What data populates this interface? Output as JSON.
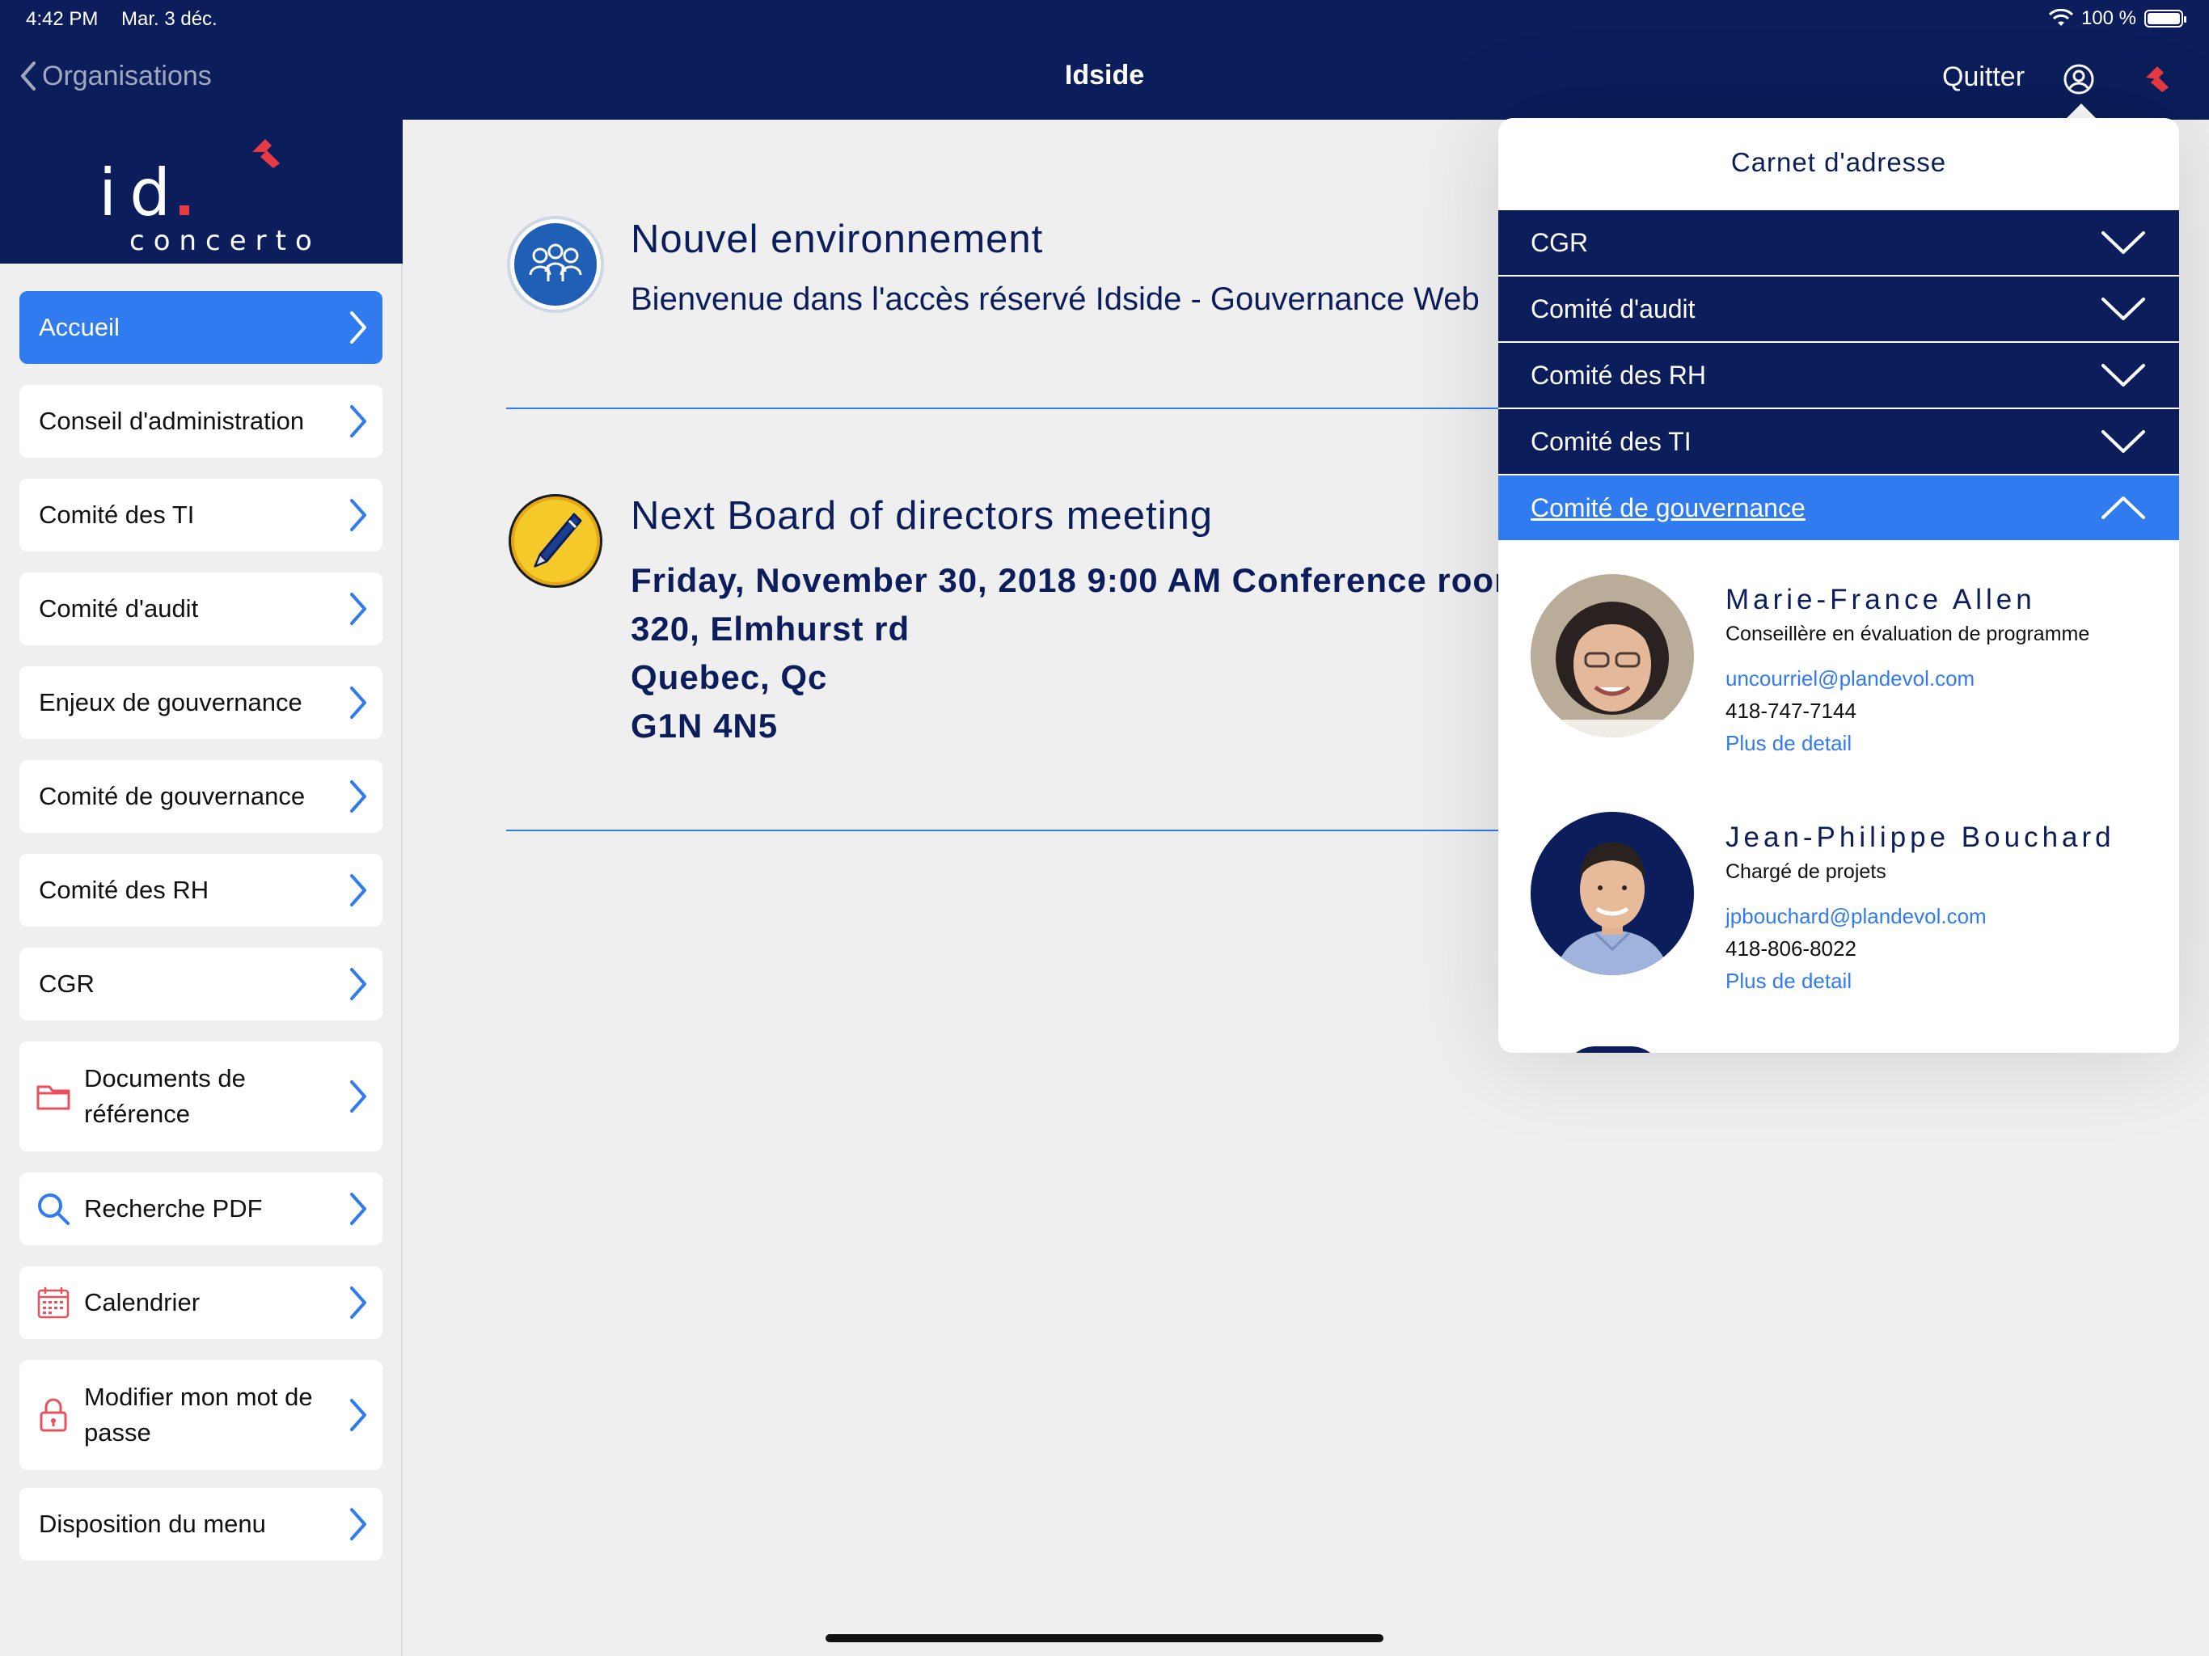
{
  "status_bar": {
    "time": "4:42 PM",
    "date": "Mar. 3 déc.",
    "battery": "100 %"
  },
  "nav": {
    "back_label": "Organisations",
    "title": "Idside",
    "quit_label": "Quitter"
  },
  "brand": {
    "id_text": "id",
    "tagline": "concerto"
  },
  "sidebar": {
    "items": [
      {
        "label": "Accueil",
        "active": true
      },
      {
        "label": "Conseil d'administration"
      },
      {
        "label": "Comité des TI"
      },
      {
        "label": "Comité d'audit"
      },
      {
        "label": "Enjeux de gouvernance"
      },
      {
        "label": "Comité de gouvernance"
      },
      {
        "label": "Comité des RH"
      },
      {
        "label": "CGR"
      },
      {
        "label": "Documents de référence",
        "icon": "folder-icon"
      },
      {
        "label": "Recherche PDF",
        "icon": "search-icon"
      },
      {
        "label": "Calendrier",
        "icon": "calendar-icon"
      },
      {
        "label": "Modifier mon mot de passe",
        "icon": "lock-icon"
      },
      {
        "label": "Disposition du menu"
      }
    ]
  },
  "news": [
    {
      "title": "Nouvel environnement",
      "subtitle": "Bienvenue dans l'accès réservé Idside - Gouvernance Web",
      "icon": "group-icon"
    },
    {
      "title": "Next Board of directors meeting",
      "lines": [
        "Friday, November 30, 2018 9:00 AM Conference room",
        "320, Elmhurst rd",
        "Quebec, Qc",
        "G1N 4N5"
      ],
      "icon": "pen-icon"
    }
  ],
  "address_book": {
    "title": "Carnet d'adresse",
    "groups": [
      {
        "label": "CGR",
        "open": false
      },
      {
        "label": "Comité d'audit",
        "open": false
      },
      {
        "label": "Comité des RH",
        "open": false
      },
      {
        "label": "Comité des TI",
        "open": false
      },
      {
        "label": "Comité de gouvernance",
        "open": true
      }
    ],
    "contacts": [
      {
        "name": "Marie-France Allen",
        "role": "Conseillère en évaluation de programme",
        "email": "uncourriel@plandevol.com",
        "phone": "418-747-7144",
        "more": "Plus de detail"
      },
      {
        "name": "Jean-Philippe Bouchard",
        "role": "Chargé de projets",
        "email": "jpbouchard@plandevol.com",
        "phone": "418-806-8022",
        "more": "Plus de detail"
      }
    ]
  },
  "colors": {
    "navy": "#0b1e5b",
    "accent": "#2f7bef",
    "brand_red": "#e63a44",
    "background": "#efeff0"
  }
}
